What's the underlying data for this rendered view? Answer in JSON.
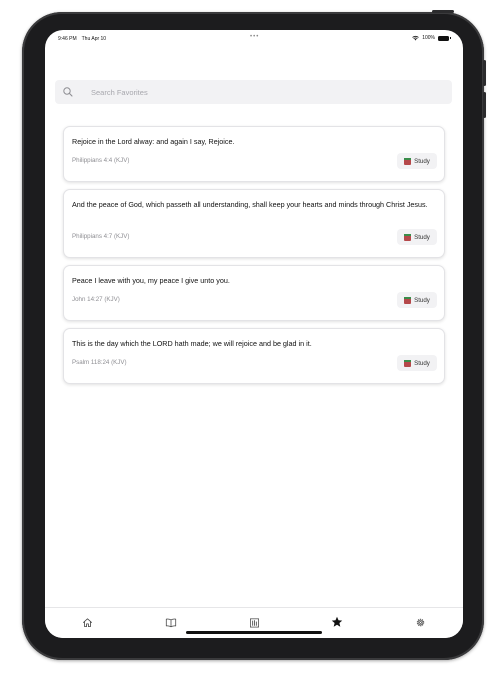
{
  "status": {
    "time": "9:46 PM",
    "date": "Thu Apr 10",
    "multitask_dots": "•••",
    "battery_pct": "100%"
  },
  "search": {
    "placeholder": "Search Favorites"
  },
  "favorites": [
    {
      "text": "Rejoice in the Lord alway: and again I say, Rejoice.",
      "reference": "Philippians 4:4 (KJV)",
      "action": "Study"
    },
    {
      "text": "And the peace of God, which passeth all understanding, shall keep your hearts and minds through Christ Jesus.",
      "reference": "Philippians 4:7 (KJV)",
      "action": "Study"
    },
    {
      "text": "Peace I leave with you, my peace I give unto you.",
      "reference": "John 14:27 (KJV)",
      "action": "Study"
    },
    {
      "text": "This is the day which the LORD hath made; we will rejoice and be glad in it.",
      "reference": "Psalm 118:24 (KJV)",
      "action": "Study"
    }
  ],
  "tabs": [
    {
      "icon": "home-icon",
      "active": false
    },
    {
      "icon": "book-open-icon",
      "active": false
    },
    {
      "icon": "library-icon",
      "active": false
    },
    {
      "icon": "star-icon",
      "active": true
    },
    {
      "icon": "gear-icon",
      "active": false
    }
  ],
  "colors": {
    "active_tab": "#111111",
    "inactive_tab": "#444444",
    "reference_text": "#8e8e93",
    "search_bg": "#f2f2f4"
  }
}
